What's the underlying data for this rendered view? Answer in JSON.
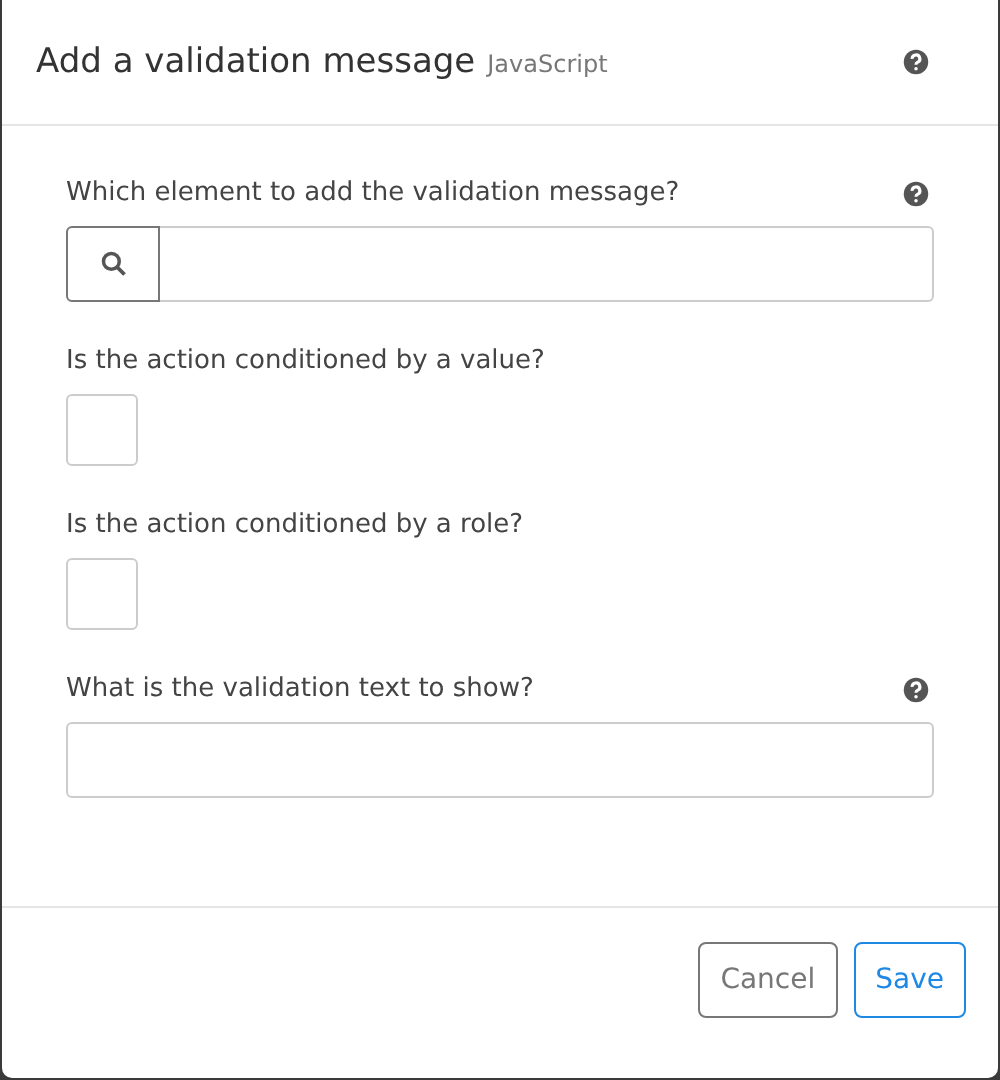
{
  "dialog": {
    "title": "Add a validation message",
    "subtitle": "JavaScript",
    "help": true
  },
  "fields": [
    {
      "kind": "search",
      "label": "Which element to add the validation message?",
      "help": true
    },
    {
      "kind": "checkbox",
      "label": "Is the action conditioned by a value?",
      "help": false,
      "checked": false
    },
    {
      "kind": "checkbox",
      "label": "Is the action conditioned by a role?",
      "help": false,
      "checked": false
    },
    {
      "kind": "text",
      "label": "What is the validation text to show?",
      "help": true
    }
  ],
  "buttons": [
    {
      "label": "Cancel",
      "kind": "secondary"
    },
    {
      "label": "Save",
      "kind": "primary"
    }
  ]
}
